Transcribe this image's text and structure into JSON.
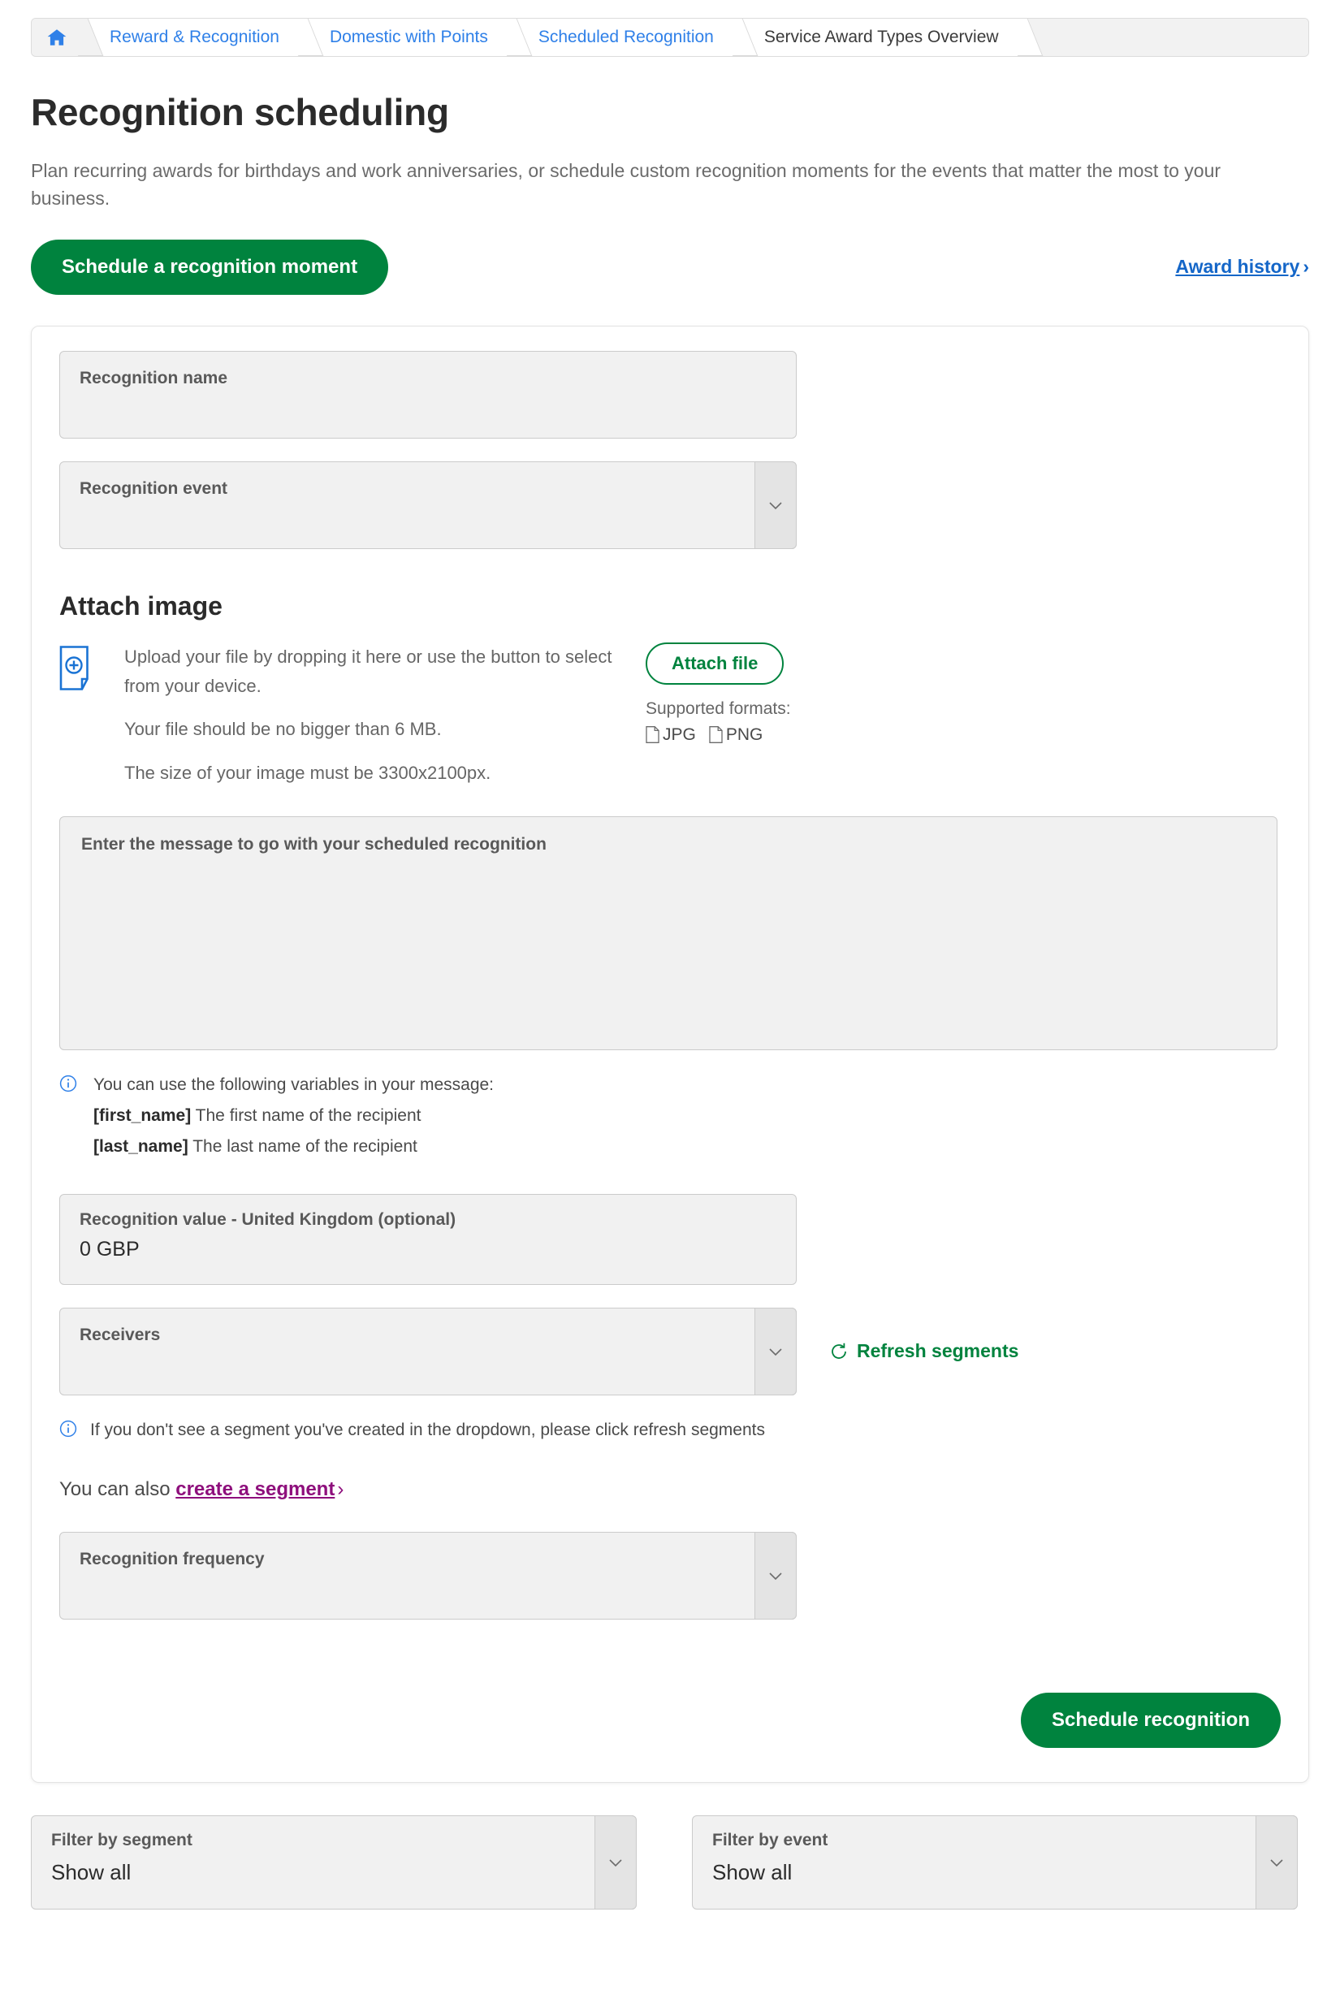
{
  "breadcrumb": {
    "home_icon": "home-icon",
    "items": [
      {
        "label": "Reward & Recognition",
        "current": false
      },
      {
        "label": "Domestic with Points",
        "current": false
      },
      {
        "label": "Scheduled Recognition",
        "current": false
      },
      {
        "label": "Service Award Types Overview",
        "current": true
      }
    ]
  },
  "header": {
    "title": "Recognition scheduling",
    "description": "Plan recurring awards for birthdays and work anniversaries, or schedule custom recognition moments for the events that matter the most to your business.",
    "primary_button": "Schedule a recognition moment",
    "history_link": "Award history",
    "history_chevron": "›"
  },
  "form": {
    "recognition_name": {
      "label": "Recognition name",
      "value": ""
    },
    "recognition_event": {
      "label": "Recognition event",
      "value": ""
    },
    "attach": {
      "heading": "Attach image",
      "upload_icon": "file-add-icon",
      "drop_text": "Upload your file by dropping it here or use the button to select from your device.",
      "size_limit_text": "Your file should be no bigger than 6 MB.",
      "dimensions_text": "The size of your image must be 3300x2100px.",
      "attach_button": "Attach file",
      "formats_label": "Supported formats:",
      "formats": [
        "JPG",
        "PNG"
      ]
    },
    "message": {
      "label": "Enter the message to go with your scheduled recognition",
      "value": ""
    },
    "variables_hint": {
      "intro": "You can use the following variables in your message:",
      "items": [
        {
          "token": "[first_name]",
          "desc": "The first name of the recipient"
        },
        {
          "token": "[last_name]",
          "desc": "The last name of the recipient"
        }
      ]
    },
    "recognition_value": {
      "label": "Recognition value - United Kingdom (optional)",
      "value": "0 GBP"
    },
    "receivers": {
      "label": "Receivers",
      "value": ""
    },
    "refresh_segments": "Refresh segments",
    "segments_hint": "If you don't see a segment you've created in the dropdown, please click refresh segments",
    "create_segment": {
      "prefix": "You can also",
      "link": "create a segment",
      "chevron": "›"
    },
    "recognition_frequency": {
      "label": "Recognition frequency",
      "value": ""
    },
    "submit_button": "Schedule recognition"
  },
  "filters": {
    "segment": {
      "label": "Filter by segment",
      "value": "Show all"
    },
    "event": {
      "label": "Filter by event",
      "value": "Show all"
    }
  },
  "colors": {
    "brand_green": "#00833e",
    "link_blue": "#2f80e8",
    "link_purple": "#8e0f7c",
    "info_blue": "#2f80e8",
    "icon_blue": "#1a73d4"
  }
}
